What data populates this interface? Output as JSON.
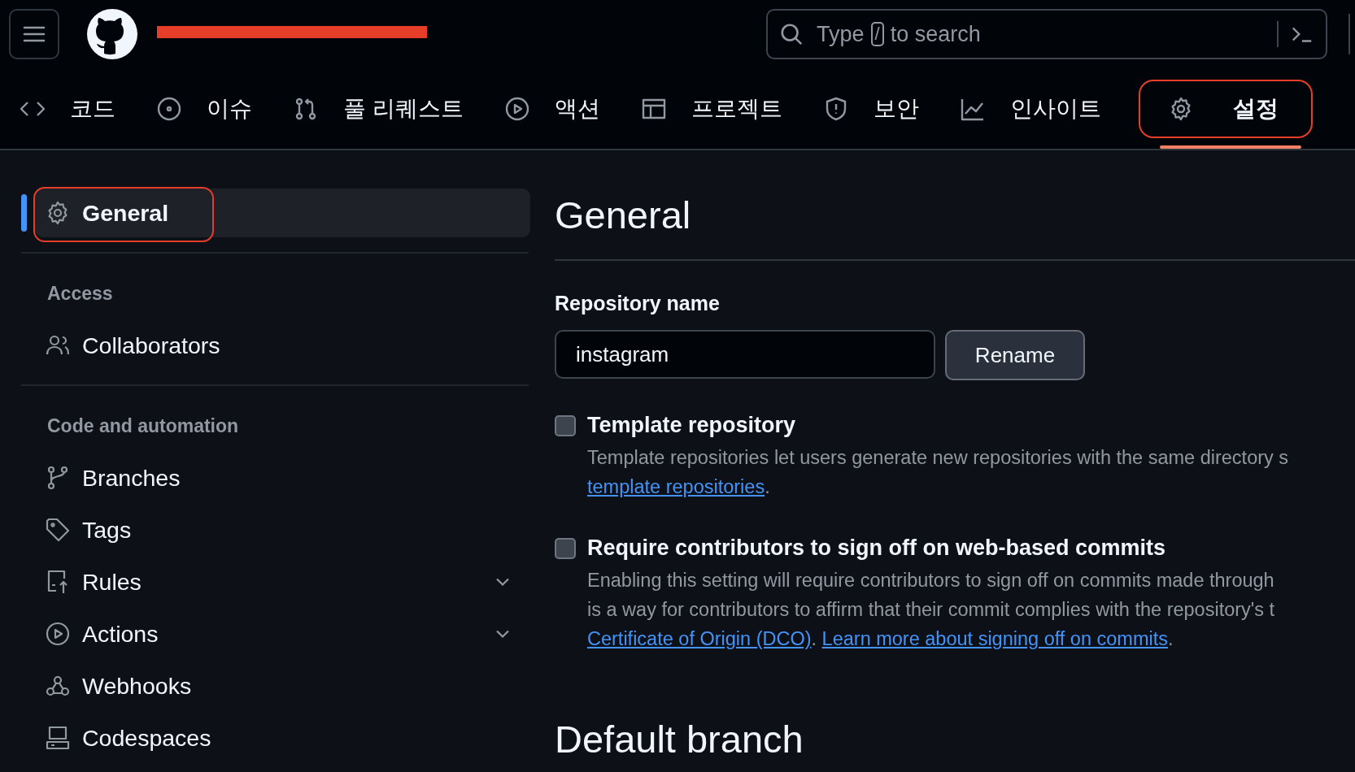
{
  "header": {
    "redacted": true,
    "search": {
      "placeholder_before": "Type",
      "key": "/",
      "placeholder_after": "to search"
    }
  },
  "tabs": [
    {
      "label": "코드",
      "selected": false,
      "highlighted": false
    },
    {
      "label": "이슈",
      "selected": false,
      "highlighted": false
    },
    {
      "label": "풀 리퀘스트",
      "selected": false,
      "highlighted": false
    },
    {
      "label": "액션",
      "selected": false,
      "highlighted": false
    },
    {
      "label": "프로젝트",
      "selected": false,
      "highlighted": false
    },
    {
      "label": "보안",
      "selected": false,
      "highlighted": false
    },
    {
      "label": "인사이트",
      "selected": false,
      "highlighted": false
    },
    {
      "label": "설정",
      "selected": true,
      "highlighted": true
    }
  ],
  "sidebar": [
    {
      "items": [
        {
          "label": "General",
          "selected": true,
          "expandable": false,
          "highlighted": true
        }
      ]
    },
    {
      "heading": "Access",
      "items": [
        {
          "label": "Collaborators",
          "selected": false,
          "expandable": false,
          "highlighted": false
        }
      ]
    },
    {
      "heading": "Code and automation",
      "items": [
        {
          "label": "Branches",
          "selected": false,
          "expandable": false,
          "highlighted": false
        },
        {
          "label": "Tags",
          "selected": false,
          "expandable": false,
          "highlighted": false
        },
        {
          "label": "Rules",
          "selected": false,
          "expandable": true,
          "highlighted": false
        },
        {
          "label": "Actions",
          "selected": false,
          "expandable": true,
          "highlighted": false
        },
        {
          "label": "Webhooks",
          "selected": false,
          "expandable": false,
          "highlighted": false
        },
        {
          "label": "Codespaces",
          "selected": false,
          "expandable": false,
          "highlighted": false
        }
      ]
    }
  ],
  "main": {
    "title": "General",
    "repo_label": "Repository name",
    "repo_value": "instagram",
    "rename_button": "Rename",
    "options": [
      {
        "label": "Template repository",
        "checked": false,
        "lines": [
          "Template repositories let users generate new repositories with the same directory s"
        ],
        "links": [
          {
            "text": "template repositories",
            "after": "."
          }
        ]
      },
      {
        "label": "Require contributors to sign off on web-based commits",
        "checked": false,
        "lines": [
          "Enabling this setting will require contributors to sign off on commits made through",
          "is a way for contributors to affirm that their commit complies with the repository's t"
        ],
        "links": [
          {
            "text": "Certificate of Origin (DCO)",
            "after": ". "
          },
          {
            "text": "Learn more about signing off on commits",
            "after": "."
          }
        ]
      }
    ],
    "next_section": "Default branch"
  }
}
